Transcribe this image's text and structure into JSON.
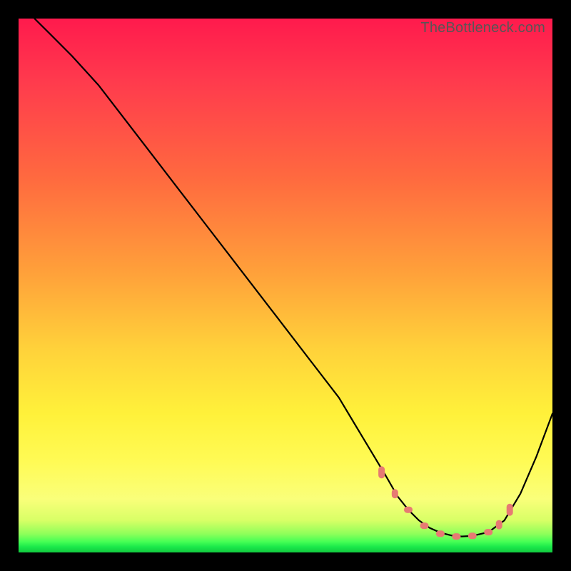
{
  "watermark": "TheBottleneck.com",
  "colors": {
    "curve_stroke": "#000000",
    "marker_fill": "#e77a73",
    "marker_stroke": "#e77a73"
  },
  "chart_data": {
    "type": "line",
    "title": "",
    "xlabel": "",
    "ylabel": "",
    "xlim": [
      0,
      100
    ],
    "ylim": [
      0,
      100
    ],
    "series": [
      {
        "name": "bottleneck-curve",
        "x": [
          3,
          6,
          10,
          15,
          20,
          25,
          30,
          35,
          40,
          45,
          50,
          55,
          60,
          63,
          66,
          69,
          71,
          73,
          75,
          77,
          79,
          81,
          83,
          85,
          88,
          91,
          94,
          97,
          100
        ],
        "y": [
          100,
          97,
          93,
          87.5,
          81,
          74.5,
          68,
          61.5,
          55,
          48.5,
          42,
          35.5,
          29,
          24,
          19,
          14,
          10.5,
          8,
          6,
          4.6,
          3.7,
          3.2,
          3.0,
          3.1,
          3.8,
          6,
          11,
          18,
          26
        ]
      }
    ],
    "markers": {
      "name": "highlight-zone",
      "x": [
        68,
        70.5,
        73,
        76,
        79,
        82,
        85,
        88,
        90,
        92
      ],
      "y": [
        15,
        11,
        8,
        5,
        3.5,
        3.0,
        3.1,
        3.8,
        5.2,
        8
      ]
    }
  }
}
